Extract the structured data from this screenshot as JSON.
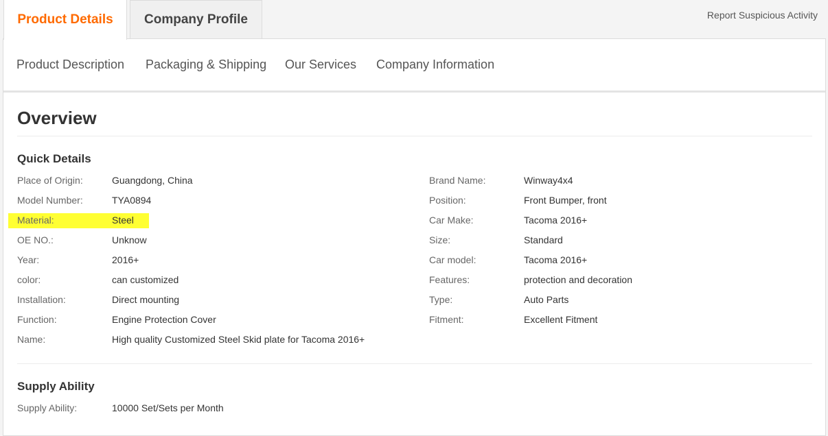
{
  "tabs": {
    "product_details": "Product Details",
    "company_profile": "Company Profile",
    "report": "Report Suspicious Activity"
  },
  "subnav": [
    "Product Description",
    "Packaging & Shipping",
    "Our Services",
    "Company Information"
  ],
  "overview": {
    "title": "Overview",
    "quick_details_title": "Quick Details",
    "left": [
      {
        "label": "Place of Origin:",
        "value": "Guangdong, China"
      },
      {
        "label": "Model Number:",
        "value": "TYA0894"
      },
      {
        "label": "Material:",
        "value": "Steel"
      },
      {
        "label": "OE NO.:",
        "value": "Unknow"
      },
      {
        "label": "Year:",
        "value": "2016+"
      },
      {
        "label": "color:",
        "value": "can customized"
      },
      {
        "label": "Installation:",
        "value": "Direct mounting"
      },
      {
        "label": "Function:",
        "value": "Engine Protection Cover"
      },
      {
        "label": "Name:",
        "value": "High quality Customized Steel Skid plate for Tacoma 2016+"
      }
    ],
    "right": [
      {
        "label": "Brand Name:",
        "value": "Winway4x4"
      },
      {
        "label": "Position:",
        "value": "Front Bumper, front"
      },
      {
        "label": "Car Make:",
        "value": "Tacoma 2016+"
      },
      {
        "label": "Size:",
        "value": "Standard"
      },
      {
        "label": "Car model:",
        "value": "Tacoma 2016+"
      },
      {
        "label": "Features:",
        "value": "protection and decoration"
      },
      {
        "label": "Type:",
        "value": "Auto Parts"
      },
      {
        "label": "Fitment:",
        "value": "Excellent Fitment"
      }
    ],
    "supply_title": "Supply Ability",
    "supply": [
      {
        "label": "Supply Ability:",
        "value": "10000 Set/Sets per Month"
      }
    ]
  }
}
